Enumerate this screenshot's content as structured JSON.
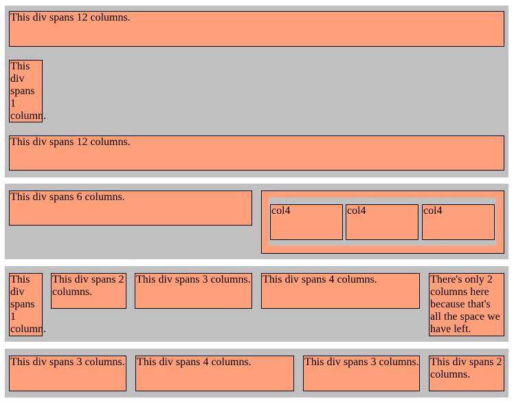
{
  "colors": {
    "box": "#ffa07a",
    "section": "#c0c0c0",
    "border": "#000000"
  },
  "row1": [
    "This div spans 12 columns.",
    "This div spans 1 column.",
    "This div spans 12 columns."
  ],
  "row2": {
    "left": "This div spans 6 columns.",
    "nested": [
      "col4",
      "col4",
      "col4"
    ]
  },
  "row3": [
    "This div spans 1 column.",
    "This div spans 2 columns.",
    "This div spans 3 columns.",
    "This div spans 4 columns.",
    "There's only 2 columns here because that's all the space we have left."
  ],
  "row4": [
    "This div spans 3 columns.",
    "This div spans 4 columns.",
    "This div spans 3 columns.",
    "This div spans 2 columns."
  ]
}
